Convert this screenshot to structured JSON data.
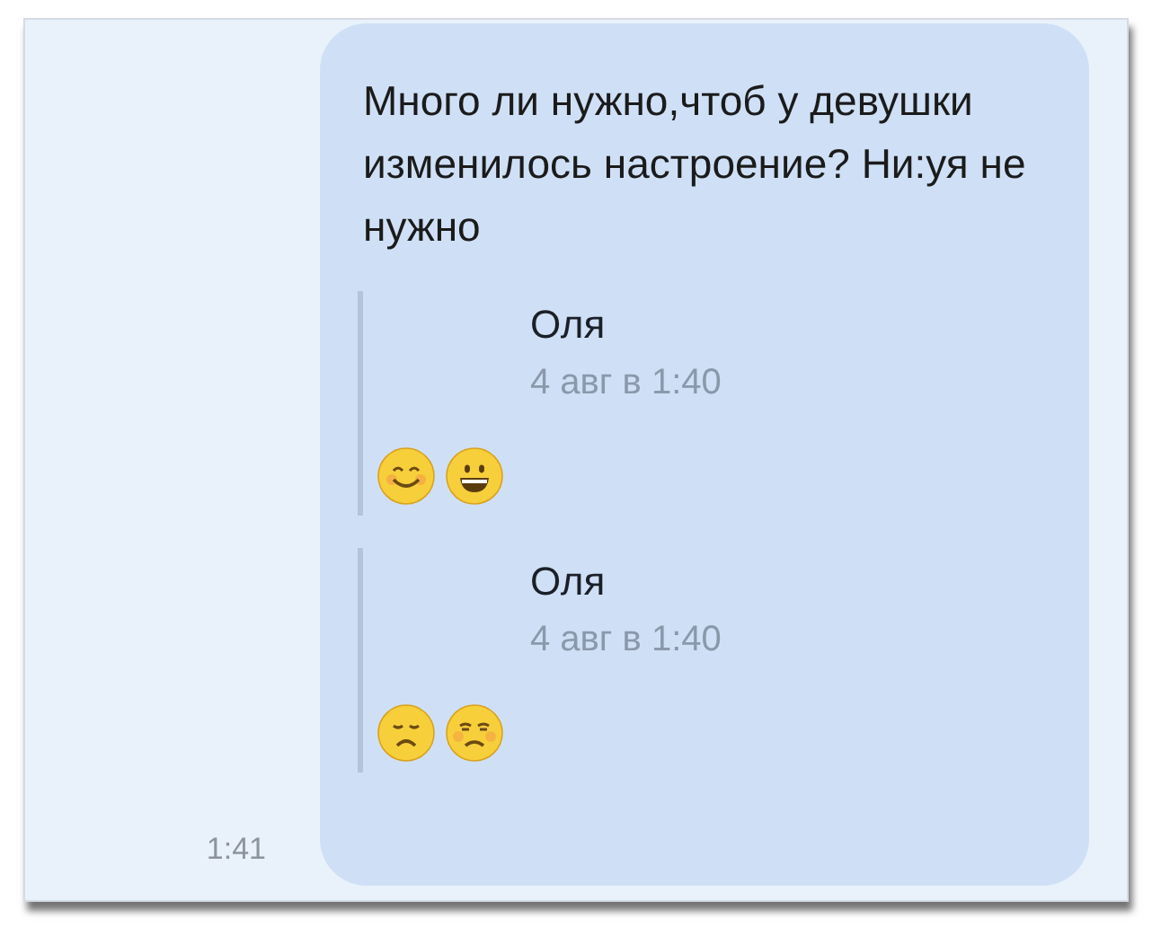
{
  "message": {
    "text": "Много ли нужно,чтоб у девушки изменилось настроение? Ни:уя не нужно",
    "time": "1:41",
    "forwarded": [
      {
        "author": "Оля",
        "date": "4 авг в 1:40",
        "emojis": [
          {
            "kind": "smiling"
          },
          {
            "kind": "grinning"
          }
        ]
      },
      {
        "author": "Оля",
        "date": "4 авг в 1:40",
        "emojis": [
          {
            "kind": "sad"
          },
          {
            "kind": "unamused"
          }
        ]
      }
    ]
  }
}
